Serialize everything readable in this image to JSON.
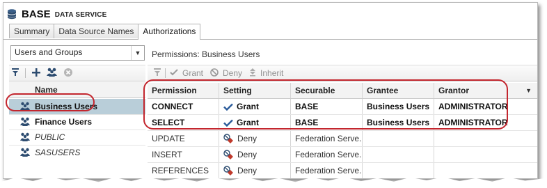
{
  "window": {
    "name": "BASE",
    "type": "DATA SERVICE"
  },
  "tabs": [
    {
      "label": "Summary"
    },
    {
      "label": "Data Source Names"
    },
    {
      "label": "Authorizations"
    }
  ],
  "left_panel": {
    "dropdown_value": "Users and Groups",
    "column_header": "Name",
    "identities": [
      {
        "name": "Business Users",
        "style": "bold",
        "selected": true
      },
      {
        "name": "Finance Users",
        "style": "bold",
        "selected": false
      },
      {
        "name": "PUBLIC",
        "style": "italic",
        "selected": false
      },
      {
        "name": "SASUSERS",
        "style": "italic",
        "selected": false
      }
    ]
  },
  "right_panel": {
    "title": "Permissions: Business Users",
    "toolbar": {
      "grant": "Grant",
      "deny": "Deny",
      "inherit": "Inherit"
    },
    "columns": [
      "Permission",
      "Setting",
      "Securable",
      "Grantee",
      "Grantor"
    ],
    "rows": [
      {
        "permission": "CONNECT",
        "setting": "Grant",
        "securable": "BASE",
        "grantee": "Business Users",
        "grantor": "ADMINISTRATOR",
        "style": "strong"
      },
      {
        "permission": "SELECT",
        "setting": "Grant",
        "securable": "BASE",
        "grantee": "Business Users",
        "grantor": "ADMINISTRATOR",
        "style": "strong"
      },
      {
        "permission": "UPDATE",
        "setting": "Deny",
        "securable": "Federation Serve...",
        "grantee": "",
        "grantor": "",
        "style": "plain"
      },
      {
        "permission": "INSERT",
        "setting": "Deny",
        "securable": "Federation Serve...",
        "grantee": "",
        "grantor": "",
        "style": "plain"
      },
      {
        "permission": "REFERENCES",
        "setting": "Deny",
        "securable": "Federation Serve...",
        "grantee": "",
        "grantor": "",
        "style": "plain"
      }
    ]
  },
  "colors": {
    "highlight": "#c3262e",
    "selection": "#b9ced9",
    "grant_check": "#2a5b9a",
    "deny_icon": "#c0392b"
  }
}
